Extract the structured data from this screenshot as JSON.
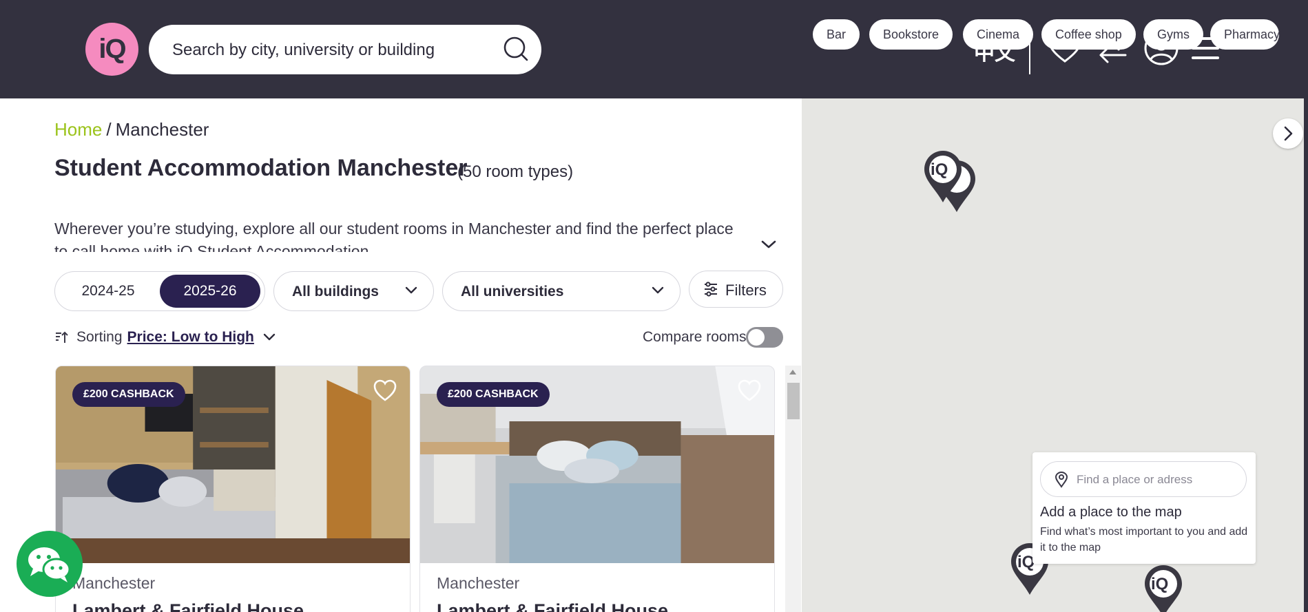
{
  "header": {
    "logo_text": "iQ",
    "search_placeholder": "Search by city, university or building",
    "language_label": "中文"
  },
  "breadcrumb": {
    "home": "Home",
    "separator": "/",
    "current": "Manchester"
  },
  "page": {
    "title": "Student Accommodation Manchester",
    "room_count": "(50 room types)",
    "description": "Wherever you’re studying, explore all our student rooms in Manchester and find the perfect place to call home with iQ Student Accommodation."
  },
  "filters": {
    "years": [
      "2024-25",
      "2025-26"
    ],
    "selected_year": "2025-26",
    "buildings_dropdown": "All buildings",
    "universities_dropdown": "All universities",
    "filters_button": "Filters"
  },
  "sorting": {
    "label": "Sorting",
    "value": "Price: Low to High",
    "compare_label": "Compare rooms",
    "compare_enabled": false
  },
  "cards": [
    {
      "badge": "£200 CASHBACK",
      "city": "Manchester",
      "name": "Lambert & Fairfield House"
    },
    {
      "badge": "£200 CASHBACK",
      "city": "Manchester",
      "name": "Lambert & Fairfield House"
    }
  ],
  "map": {
    "categories": [
      "Bar",
      "Bookstore",
      "Cinema",
      "Coffee shop",
      "Gyms",
      "Pharmacy"
    ],
    "pin_label": "iQ",
    "place_card": {
      "input_placeholder": "Find a place or adress",
      "title": "Add a place to the map",
      "description": "Find what’s most important to you and add it to the map"
    }
  },
  "colors": {
    "header_bg": "#33313f",
    "brand_pink": "#f58bbf",
    "primary_navy": "#2a2150",
    "home_link": "#9bc31b",
    "chat_green": "#1aad55"
  }
}
